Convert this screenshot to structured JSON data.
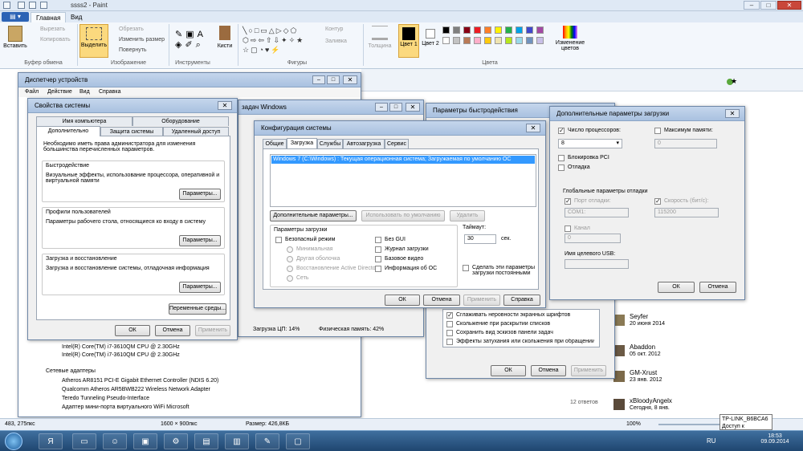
{
  "paint": {
    "title": "ssss2 - Paint",
    "tabs": {
      "menu": "",
      "home": "Главная",
      "view": "Вид"
    },
    "ribbon": {
      "paste": "Вставить",
      "cut": "Вырезать",
      "copy": "Копировать",
      "clipboard": "Буфер обмена",
      "select": "Выделить",
      "crop": "Обрезать",
      "resize": "Изменить размер",
      "rotate": "Повернуть",
      "image": "Изображение",
      "tools": "Инструменты",
      "brushes": "Кисти",
      "shapes": "Фигуры",
      "outline": "Контур",
      "fill": "Заливка",
      "size": "Толщина",
      "color1": "Цвет 1",
      "color2": "Цвет 2",
      "edit_colors": "Изменение цветов",
      "colors": "Цвета"
    },
    "palette": [
      "#000000",
      "#7f7f7f",
      "#880015",
      "#ed1c24",
      "#ff7f27",
      "#fff200",
      "#22b14c",
      "#00a2e8",
      "#3f48cc",
      "#a349a4",
      "#ffffff",
      "#c3c3c3",
      "#b97a57",
      "#ffaec9",
      "#ffc90e",
      "#efe4b0",
      "#b5e61d",
      "#99d9ea",
      "#7092be",
      "#c8bfe7"
    ],
    "status": {
      "cursor": "483, 275пкс",
      "dims": "1600 × 900пкс",
      "size": "Размер: 426,8КБ",
      "zoom": "100%"
    }
  },
  "devmgr": {
    "title": "Диспетчер устройств",
    "menu": [
      "Файл",
      "Действие",
      "Вид",
      "Справка"
    ],
    "items": [
      "Intel(R) Core(TM) i7-3610QM CPU @ 2.30GHz",
      "Intel(R) Core(TM) i7-3610QM CPU @ 2.30GHz",
      "Сетевые адаптеры",
      "Atheros AR8151 PCI-E Gigabit Ethernet Controller (NDIS 6.20)",
      "Qualcomm Atheros AR5BWB222 Wireless Network Adapter",
      "Teredo Tunneling Pseudo-Interface",
      "Адаптер мини-порта виртуального WiFi Microsoft"
    ]
  },
  "taskmgr": {
    "title": "задач Windows",
    "cpu": "Загрузка ЦП: 14%",
    "mem": "Физическая память: 42%"
  },
  "sysprops": {
    "title": "Свойства системы",
    "tabs_top": [
      "Имя компьютера",
      "Оборудование"
    ],
    "tabs_bottom": [
      "Дополнительно",
      "Защита системы",
      "Удаленный доступ"
    ],
    "intro": "Необходимо иметь права администратора для изменения большинства перечисленных параметров.",
    "perf_title": "Быстродействие",
    "perf_text": "Визуальные эффекты, использование процессора, оперативной и виртуальной памяти",
    "profiles_title": "Профили пользователей",
    "profiles_text": "Параметры рабочего стола, относящиеся ко входу в систему",
    "startup_title": "Загрузка и восстановление",
    "startup_text": "Загрузка и восстановление системы, отладочная информация",
    "params": "Параметры...",
    "env": "Переменные среды...",
    "ok": "ОК",
    "cancel": "Отмена",
    "apply": "Применить"
  },
  "msconfig": {
    "title": "Конфигурация системы",
    "tabs": [
      "Общие",
      "Загрузка",
      "Службы",
      "Автозагрузка",
      "Сервис"
    ],
    "entry": "Windows 7 (C:\\Windows) : Текущая операционная система; Загружаемая по умолчанию ОС",
    "advanced": "Дополнительные параметры...",
    "default": "Использовать по умолчанию",
    "delete": "Удалить",
    "boot_params": "Параметры загрузки",
    "safe": "Безопасный режим",
    "minimal": "Минимальная",
    "altshell": "Другая оболочка",
    "adrepair": "Восстановление Active Directory",
    "network": "Сеть",
    "nogui": "Без GUI",
    "bootlog": "Журнал загрузки",
    "basevideo": "Базовое видео",
    "osinfo": "Информация об ОС",
    "timeout_label": "Таймаут:",
    "timeout": "30",
    "sec": "сек.",
    "permanent": "Сделать эти параметры загрузки постоянными",
    "ok": "ОК",
    "cancel": "Отмена",
    "apply": "Применить",
    "help": "Справка"
  },
  "perfopts": {
    "title": "Параметры быстродействия",
    "items": [
      "Сглаживать неровности экранных шрифтов",
      "Скольжение при раскрытии списков",
      "Сохранить вид эскизов панели задач",
      "Эффекты затухания или скольжения при обращении к"
    ],
    "ok": "ОК",
    "cancel": "Отмена",
    "apply": "Применить"
  },
  "advboot": {
    "title": "Дополнительные параметры загрузки",
    "numproc": "Число процессоров:",
    "numproc_val": "8",
    "maxmem": "Максимум памяти:",
    "maxmem_val": "0",
    "pcilock": "Блокировка PCI",
    "debug": "Отладка",
    "global": "Глобальные параметры отладки",
    "port": "Порт отладки:",
    "port_val": "COM1:",
    "speed": "Скорость (бит/с):",
    "speed_val": "115200",
    "channel": "Канал",
    "channel_val": "0",
    "usb": "Имя целевого USB:",
    "ok": "ОК",
    "cancel": "Отмена"
  },
  "background": {
    "users": [
      {
        "name": "Seyfer",
        "date": "20 июня 2014"
      },
      {
        "name": "Abaddon",
        "date": "05 окт. 2012"
      },
      {
        "name": "GM-Xrust",
        "date": "23 янв. 2012"
      },
      {
        "name": "xBloodyAngelx",
        "date": "Сегодня, 8 янв."
      }
    ],
    "answers": "12 ответов"
  },
  "tray": {
    "lang": "RU",
    "time": "18:53",
    "date": "09.09.2014",
    "tooltip1": "TP-LINK_B6BCA6",
    "tooltip2": "Доступ к Интернету"
  }
}
